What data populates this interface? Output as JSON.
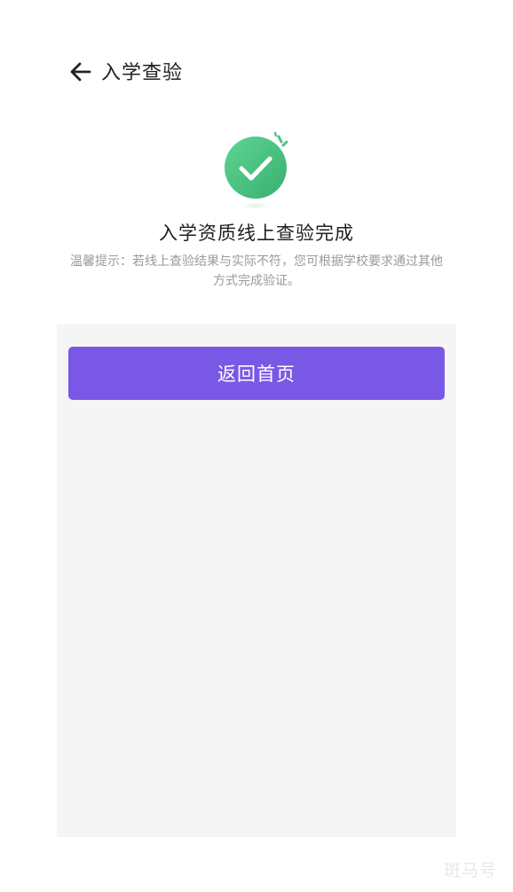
{
  "header": {
    "back_icon": "arrow-left-icon",
    "title": "入学查验"
  },
  "result": {
    "icon": "check-circle-icon",
    "title": "入学资质线上查验完成",
    "tip": "温馨提示：若线上查验结果与实际不符，您可根据学校要求通过其他方式完成验证。"
  },
  "actions": {
    "home_button_label": "返回首页"
  },
  "watermark": {
    "text": "斑马号"
  },
  "colors": {
    "accent": "#7a58e6",
    "success": "#4ec383",
    "panel_background": "#f5f5f5"
  }
}
